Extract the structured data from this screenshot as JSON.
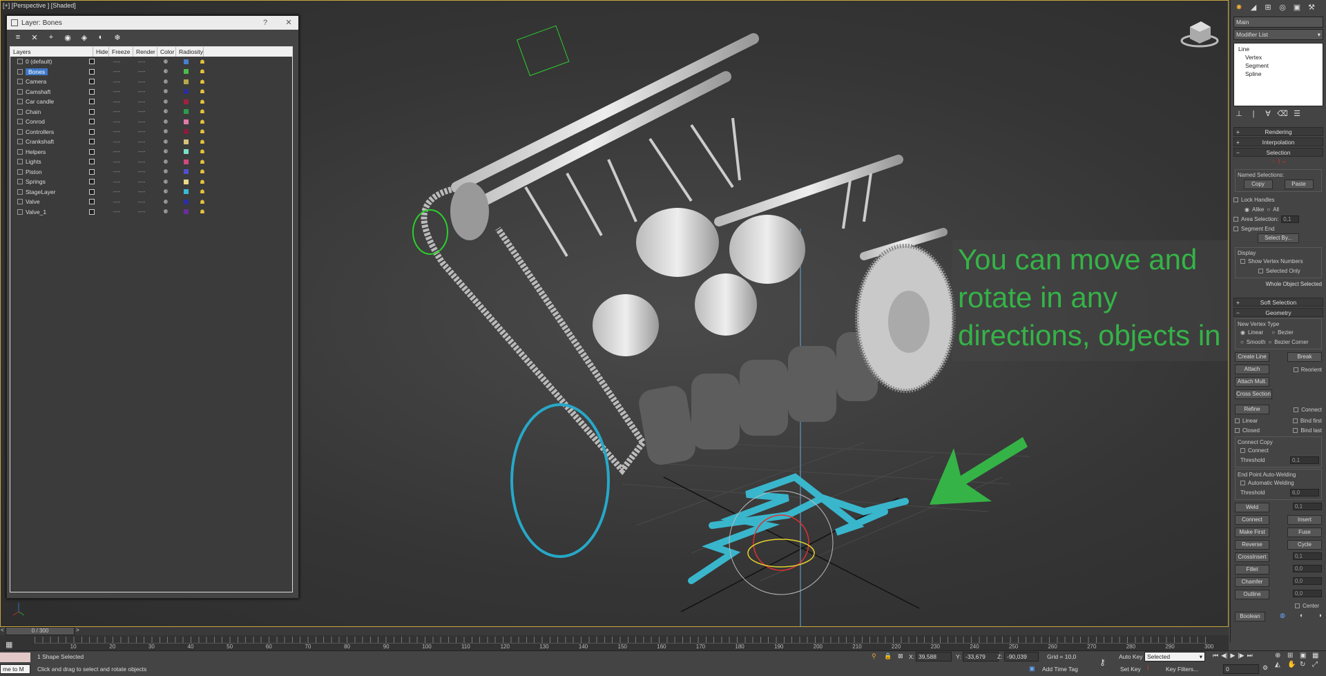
{
  "viewport": {
    "label": "[+] [Perspective ] [Shaded]",
    "overlay_lines": [
      "You can move and",
      "rotate in any",
      "directions, objects in"
    ],
    "accent_color": "#35b347"
  },
  "layer_dialog": {
    "title": "Layer: Bones",
    "help": "?",
    "close": "✕",
    "toolbar": [
      "layers-icon",
      "delete-icon",
      "add-icon",
      "select-icon",
      "highlight-icon",
      "hide-icon",
      "freeze-icon"
    ],
    "columns": [
      "Layers",
      "Hide",
      "Freeze",
      "Render",
      "Color",
      "Radiosity"
    ],
    "layers": [
      {
        "name": "0 (default)",
        "color": "#4a7fd0",
        "selected": false
      },
      {
        "name": "Bones",
        "color": "#4dbb4d",
        "selected": true
      },
      {
        "name": "Camera",
        "color": "#b8a648",
        "selected": false
      },
      {
        "name": "Camshaft",
        "color": "#2d2d9c",
        "selected": false
      },
      {
        "name": "Car candle",
        "color": "#a02040",
        "selected": false
      },
      {
        "name": "Chain",
        "color": "#2e9a4e",
        "selected": false
      },
      {
        "name": "Conrod",
        "color": "#e07aa8",
        "selected": false
      },
      {
        "name": "Controllers",
        "color": "#8c1c3c",
        "selected": false
      },
      {
        "name": "Crankshaft",
        "color": "#d8c07a",
        "selected": false
      },
      {
        "name": "Helpers",
        "color": "#7ae0c8",
        "selected": false
      },
      {
        "name": "Lights",
        "color": "#d04a80",
        "selected": false
      },
      {
        "name": "Piston",
        "color": "#5050d0",
        "selected": false
      },
      {
        "name": "Springs",
        "color": "#e8d88a",
        "selected": false
      },
      {
        "name": "StageLayer",
        "color": "#3ab8d8",
        "selected": false
      },
      {
        "name": "Valve",
        "color": "#2d2da8",
        "selected": false
      },
      {
        "name": "Valve_1",
        "color": "#6a2d9c",
        "selected": false
      }
    ],
    "cell_dashes": "----"
  },
  "command_panel": {
    "object_name": "Main",
    "modifier_list": "Modifier List",
    "stack": [
      "Line",
      "Vertex",
      "Segment",
      "Spline"
    ],
    "rollouts": {
      "rendering": "Rendering",
      "interpolation": "Interpolation",
      "selection": "Selection",
      "soft_selection": "Soft Selection",
      "geometry": "Geometry"
    },
    "named_selections": "Named Selections:",
    "copy": "Copy",
    "paste": "Paste",
    "lock_handles": "Lock Handles",
    "alike": "Alike",
    "all": "All",
    "area_selection": "Area Selection:",
    "area_value": "0,1",
    "segment_end": "Segment End",
    "select_by": "Select By...",
    "display": "Display",
    "show_vertex_numbers": "Show Vertex Numbers",
    "selected_only": "Selected Only",
    "whole_object": "Whole Object Selected",
    "new_vertex_type": "New Vertex Type",
    "linear": "Linear",
    "bezier": "Bezier",
    "smooth": "Smooth",
    "bezier_corner": "Bezier Corner",
    "create_line": "Create Line",
    "break": "Break",
    "attach": "Attach",
    "reorient": "Reorient",
    "attach_mult": "Attach Mult.",
    "cross_section": "Cross Section",
    "refine": "Refine",
    "connect": "Connect",
    "linear2": "Linear",
    "bind_first": "Bind first",
    "closed": "Closed",
    "bind_last": "Bind last",
    "connect_copy": "Connect Copy",
    "connect2": "Connect",
    "threshold": "Threshold",
    "threshold_val": "0,1",
    "end_point_welding": "End Point Auto-Welding",
    "automatic_welding": "Automatic Welding",
    "threshold_val2": "6,0",
    "weld": "Weld",
    "weld_val": "0,1",
    "connect3": "Connect",
    "insert": "Insert",
    "make_first": "Make First",
    "fuse": "Fuse",
    "reverse": "Reverse",
    "cycle": "Cycle",
    "crossinsert": "CrossInsert",
    "crossinsert_val": "0,1",
    "fillet": "Fillet",
    "fillet_val": "0,0",
    "chamfer": "Chamfer",
    "chamfer_val": "0,0",
    "outline": "Outline",
    "outline_val": "0,0",
    "center": "Center",
    "boolean": "Boolean"
  },
  "timeline": {
    "frame": "0 / 300",
    "ticks": [
      "10",
      "20",
      "30",
      "40",
      "50",
      "60",
      "70",
      "80",
      "90",
      "100",
      "110",
      "120",
      "130",
      "140",
      "150",
      "160",
      "170",
      "180",
      "190",
      "200",
      "210",
      "220",
      "230",
      "240",
      "250",
      "260",
      "270",
      "280",
      "290",
      "300"
    ]
  },
  "status": {
    "selection": "1 Shape Selected",
    "prompt": "Click and drag to select and rotate objects",
    "maxscript": "me to M",
    "x_label": "X:",
    "x": "39,588",
    "y_label": "Y:",
    "y": "-33,679",
    "z_label": "Z:",
    "z": "-90,039",
    "grid": "Grid = 10,0",
    "add_time_tag": "Add Time Tag",
    "auto_key": "Auto Key",
    "set_key": "Set Key",
    "selected": "Selected",
    "key_filters": "Key Filters...",
    "frame_field": "0"
  }
}
